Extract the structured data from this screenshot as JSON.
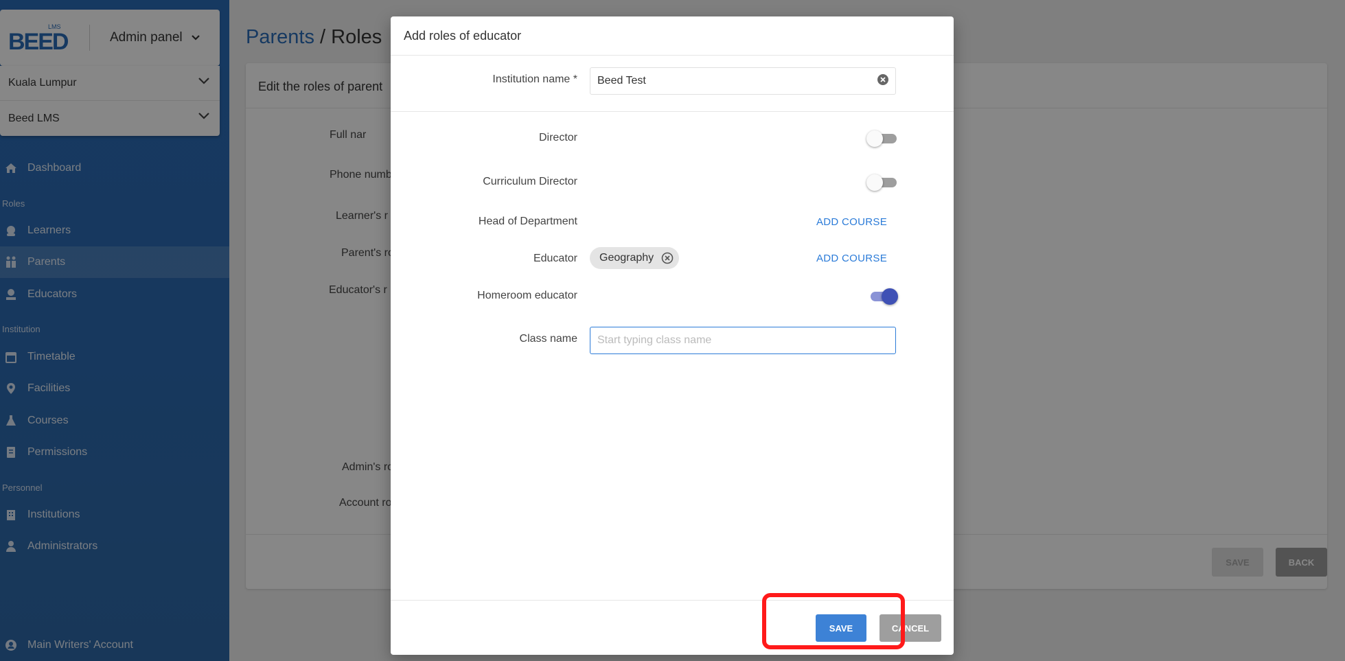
{
  "brand": {
    "logo_text": "BEED",
    "logo_sub": "LMS",
    "panel_title": "Admin panel"
  },
  "selectors": [
    {
      "value": "Kuala Lumpur"
    },
    {
      "value": "Beed LMS"
    }
  ],
  "sidebar": {
    "dashboard": "Dashboard",
    "sections": {
      "roles": "Roles",
      "institution": "Institution",
      "personnel": "Personnel"
    },
    "roles_items": [
      "Learners",
      "Parents",
      "Educators"
    ],
    "institution_items": [
      "Timetable",
      "Facilities",
      "Courses",
      "Permissions"
    ],
    "personnel_items": [
      "Institutions",
      "Administrators"
    ],
    "account": "Main Writers' Account"
  },
  "main": {
    "breadcrumb": "Parents",
    "separator": "/",
    "current": "Roles",
    "card_title": "Edit the roles of parent",
    "field_labels": [
      "Full nar",
      "Phone numb",
      "Learner's r",
      "Parent's ro",
      "Educator's r",
      "Admin's ro",
      "Account ro"
    ],
    "save_label": "SAVE",
    "back_label": "BACK"
  },
  "modal": {
    "title": "Add roles of educator",
    "institution_label": "Institution name *",
    "institution_value": "Beed Test",
    "director_label": "Director",
    "curriculum_label": "Curriculum Director",
    "hod_label": "Head of Department",
    "educator_label": "Educator",
    "homeroom_label": "Homeroom educator",
    "class_label": "Class name",
    "class_placeholder": "Start typing class name",
    "add_course": "ADD COURSE",
    "educator_chip": "Geography",
    "save_label": "SAVE",
    "cancel_label": "CANCEL",
    "toggles": {
      "director": false,
      "curriculum": false,
      "homeroom": true
    }
  },
  "colors": {
    "sidebar": "#2b6cb8",
    "primary": "#3d82d6",
    "highlight": "#ff1a1a",
    "toggle_on": "#3f51b5"
  }
}
